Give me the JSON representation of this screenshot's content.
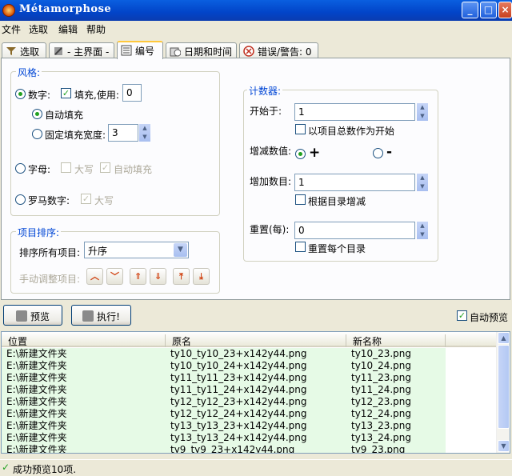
{
  "window": {
    "title": "Métamorphose"
  },
  "menu": [
    "文件",
    "选取",
    "编辑",
    "帮助"
  ],
  "tabs": [
    {
      "label": "选取",
      "icon": "funnel-icon"
    },
    {
      "label": "- 主界面 -",
      "icon": "tool-icon"
    },
    {
      "label": "编号",
      "icon": "list-icon"
    },
    {
      "label": "日期和时间",
      "icon": "calendar-icon"
    },
    {
      "label": "错误/警告: 0",
      "icon": "error-icon"
    }
  ],
  "style": {
    "title": "风格:",
    "number_label": "数字:",
    "pad_label": "填充,使用:",
    "pad_value": "0",
    "auto_pad_label": "自动填充",
    "fixed_pad_label": "固定填充宽度:",
    "fixed_pad_value": "3",
    "letters_label": "字母:",
    "uppercase_label": "大写",
    "letters_auto_pad_label": "自动填充",
    "roman_label": "罗马数字:",
    "roman_upper_label": "大写"
  },
  "sort": {
    "title": "项目排序:",
    "sort_label": "排序所有项目:",
    "sort_value": "升序",
    "manual_label": "手动调整项目:"
  },
  "counter": {
    "title": "计数器:",
    "start_label": "开始于:",
    "start_value": "1",
    "start_total_label": "以项目总数作为开始",
    "increment_label": "增减数值:",
    "plus_label": "+",
    "minus_label": "-",
    "step_label": "增加数目:",
    "step_value": "1",
    "by_dir_label": "根据目录增减",
    "reset_label": "重置(每):",
    "reset_value": "0",
    "reset_dir_label": "重置每个目录"
  },
  "actions": {
    "preview_label": "预览",
    "execute_label": "执行!",
    "auto_preview_label": "自动预览"
  },
  "list": {
    "headers": [
      "位置",
      "原名",
      "新名称"
    ],
    "rows": [
      [
        "E:\\新建文件夹",
        "ty10_ty10_23+x142y44.png",
        "ty10_23.png"
      ],
      [
        "E:\\新建文件夹",
        "ty10_ty10_24+x142y44.png",
        "ty10_24.png"
      ],
      [
        "E:\\新建文件夹",
        "ty11_ty11_23+x142y44.png",
        "ty11_23.png"
      ],
      [
        "E:\\新建文件夹",
        "ty11_ty11_24+x142y44.png",
        "ty11_24.png"
      ],
      [
        "E:\\新建文件夹",
        "ty12_ty12_23+x142y44.png",
        "ty12_23.png"
      ],
      [
        "E:\\新建文件夹",
        "ty12_ty12_24+x142y44.png",
        "ty12_24.png"
      ],
      [
        "E:\\新建文件夹",
        "ty13_ty13_23+x142y44.png",
        "ty13_23.png"
      ],
      [
        "E:\\新建文件夹",
        "ty13_ty13_24+x142y44.png",
        "ty13_24.png"
      ],
      [
        "E:\\新建文件夹",
        "ty9_ty9_23+x142y44.png",
        "ty9_23.png"
      ]
    ]
  },
  "status": {
    "text": "成功预览10项."
  }
}
